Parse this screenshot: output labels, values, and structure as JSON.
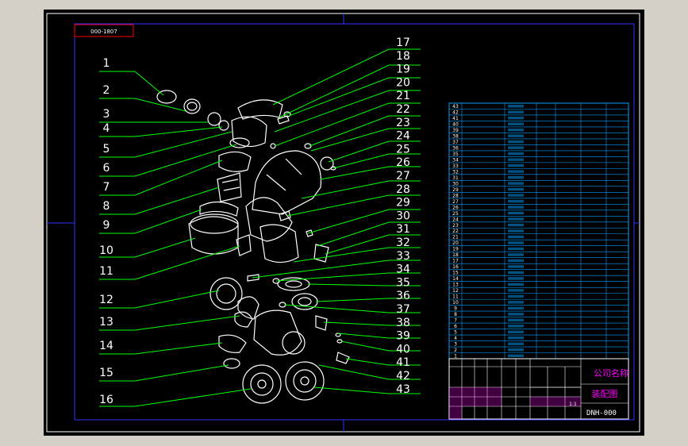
{
  "drawing": {
    "tag": "000-1807",
    "colors": {
      "background": "#000000",
      "frame": "#3030ff",
      "leader": "#00ff00",
      "label": "#ffffff",
      "parts_table": "#00a0ff",
      "title_block": "#ffffff",
      "title_text": "#ff00ff",
      "tag_box": "#ff0000"
    },
    "left_numbers": [
      "1",
      "2",
      "3",
      "4",
      "5",
      "6",
      "7",
      "8",
      "9",
      "10",
      "11",
      "12",
      "13",
      "14",
      "15",
      "16"
    ],
    "right_numbers": [
      "17",
      "18",
      "19",
      "20",
      "21",
      "22",
      "23",
      "24",
      "25",
      "26",
      "27",
      "28",
      "29",
      "30",
      "31",
      "32",
      "33",
      "34",
      "35",
      "36",
      "37",
      "38",
      "39",
      "40",
      "41",
      "42",
      "43"
    ],
    "parts_rows": [
      "43",
      "42",
      "41",
      "40",
      "39",
      "38",
      "37",
      "36",
      "35",
      "34",
      "33",
      "32",
      "31",
      "30",
      "29",
      "28",
      "27",
      "26",
      "25",
      "24",
      "23",
      "22",
      "21",
      "20",
      "19",
      "18",
      "17",
      "16",
      "15",
      "14",
      "13",
      "12",
      "11",
      "10",
      "9",
      "8",
      "7",
      "6",
      "5",
      "4",
      "3",
      "2",
      "1"
    ],
    "title_block": {
      "company": "公司名称",
      "drawing_name": "装配图",
      "drawing_number": "DNH-000",
      "scale": "1:1"
    }
  }
}
